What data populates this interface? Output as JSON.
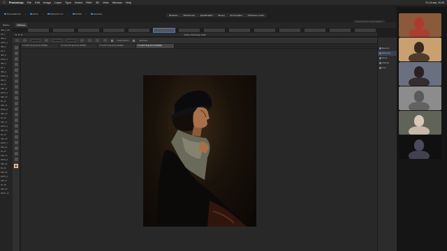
{
  "menubar": {
    "app": "Photoshop",
    "items": [
      "File",
      "Edit",
      "Image",
      "Layer",
      "Type",
      "Select",
      "Filter",
      "3D",
      "View",
      "Window",
      "Help"
    ],
    "status": "Пт 16 апр. 20:05"
  },
  "breadcrumbs": [
    "Пользователи",
    "admin",
    "Рабочий стол",
    "ZOOM",
    "минимов"
  ],
  "top_tabs": [
    "Финансы",
    "Библиотеки",
    "Дизайнфайл",
    "Выход",
    "Фотографии",
    "Облачные слоки"
  ],
  "cloud_button": "Сохранение на все файлы",
  "home_tabs": [
    "Файлы",
    "Рабочее"
  ],
  "ps_window_title": "Adobe Photoshop 2020",
  "doc_tabs": [
    "TT-C1577.NF @ 26,7% (RGB/8)",
    "TT-C1577.NF @ 26,7% (RGB/8)",
    "TT-C1577.tif @ 33,3% (RGB/8)",
    "TT-C1577.tif @ 26,7% (RGB/8)"
  ],
  "options_bar": {
    "label1": "Узкая область",
    "label2": "Заполнить"
  },
  "right_panels": [
    "Выделите",
    "Adobe Stoc",
    "Настро",
    "Свойства",
    "Слои"
  ],
  "finder_files": [
    "ЭКО_1_КИ",
    "КО_1",
    "ЭКО_2",
    "ФОТО_1",
    "ЭКО_3",
    "КО_4",
    "ЭКО_5",
    "ФОТО_2",
    "ЭКО_6",
    "КО_7",
    "ЭКО_8",
    "ФОТО_3",
    "ЭКО_9",
    "КО_10",
    "ЭКО_11",
    "ФОТО_4",
    "ЭКО_12",
    "КО_13",
    "ЭКО_14",
    "ФОТО_5",
    "ЭКО_15",
    "КО_16",
    "ЭКО_17",
    "ФОТО_6",
    "ЭКО_18",
    "КО_19",
    "ЭКО_20",
    "ФОТО_7",
    "ЭКО_21",
    "КО_22",
    "ЭКО_23",
    "ФОТО_8",
    "ЭКО_24",
    "КО_25",
    "ЭКО_26",
    "ФОТО_9",
    "ЭКО_27",
    "КО_28",
    "ЭКО_29",
    "ФОТО_10"
  ],
  "colors": {
    "accent": "#3c8bd9",
    "canvas": "#282828",
    "panel": "#2f2f2f"
  },
  "participants": [
    {
      "bg": "#8a5a3a",
      "person": "#b03a2e"
    },
    {
      "bg": "#c9a070",
      "person": "#3a2a1e"
    },
    {
      "bg": "#6a7080",
      "person": "#2a2020"
    },
    {
      "bg": "#8c8c8c",
      "person": "#5a5a5a"
    },
    {
      "bg": "#606458",
      "person": "#d8c8b8"
    },
    {
      "bg": "#101010",
      "person": "#4a4a5a"
    }
  ]
}
